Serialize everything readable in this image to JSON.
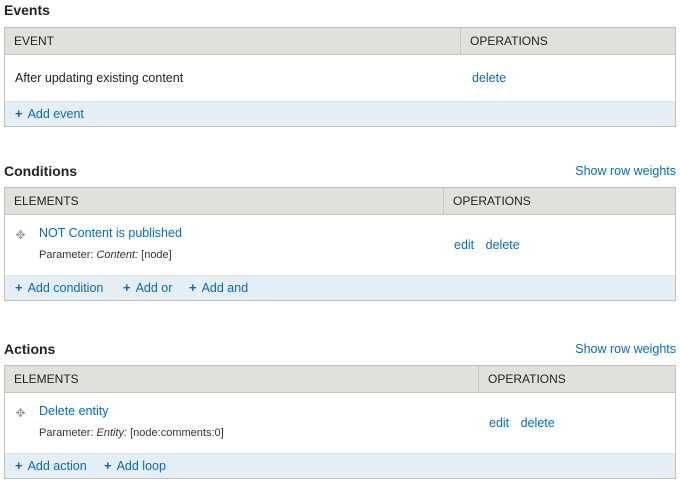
{
  "events": {
    "title": "Events",
    "columns": {
      "first": "EVENT",
      "ops": "OPERATIONS"
    },
    "row": {
      "label": "After updating existing content",
      "delete": "delete"
    },
    "add_event": "Add event"
  },
  "conditions": {
    "title": "Conditions",
    "show_weights": "Show row weights",
    "columns": {
      "first": "ELEMENTS",
      "ops": "OPERATIONS"
    },
    "row": {
      "label": "NOT Content is published",
      "param_prefix": "Parameter:",
      "param_name": "Content:",
      "param_value": "[node]",
      "edit": "edit",
      "delete": "delete"
    },
    "add_condition": "Add condition",
    "add_or": "Add or",
    "add_and": "Add and"
  },
  "actions": {
    "title": "Actions",
    "show_weights": "Show row weights",
    "columns": {
      "first": "ELEMENTS",
      "ops": "OPERATIONS"
    },
    "row": {
      "label": "Delete entity",
      "param_prefix": "Parameter:",
      "param_name": "Entity:",
      "param_value": "[node:comments:0]",
      "edit": "edit",
      "delete": "delete"
    },
    "add_action": "Add action",
    "add_loop": "Add loop"
  },
  "icons": {
    "plus": "+",
    "drag": "✥"
  }
}
